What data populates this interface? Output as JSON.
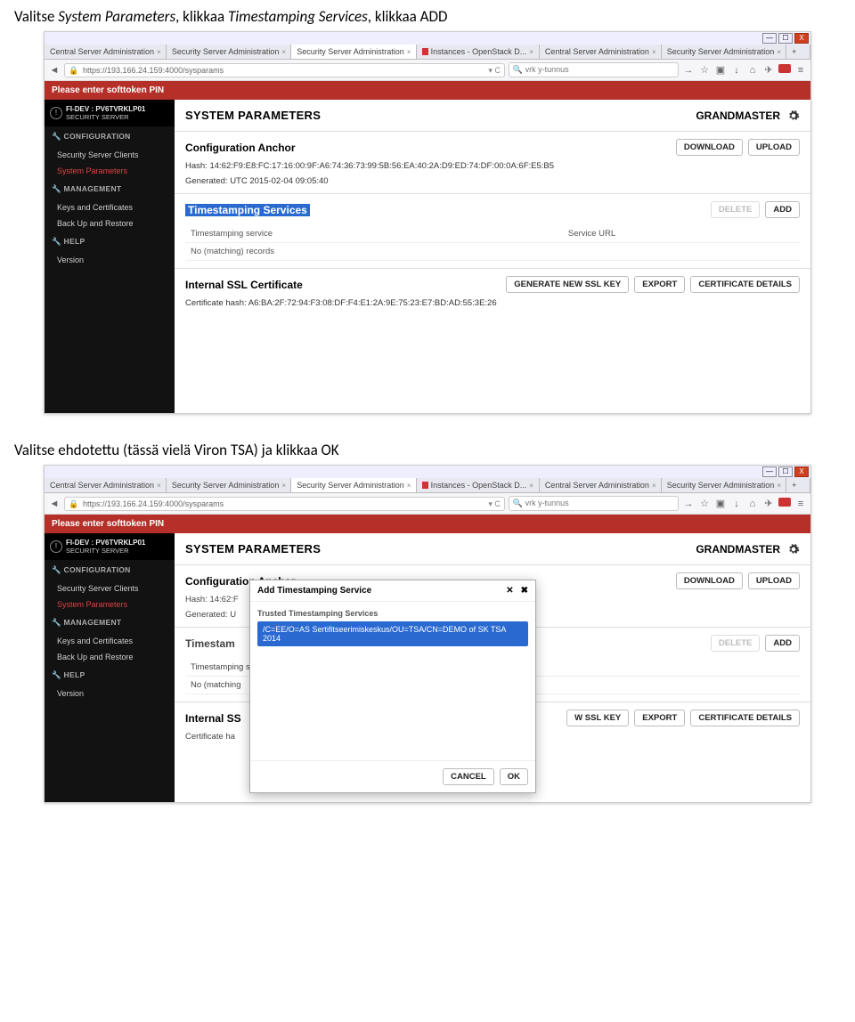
{
  "doc": {
    "line1_prefix": "Valitse ",
    "line1_em1": "System Parameters",
    "line1_mid": ", klikkaa ",
    "line1_em2": "Timestamping Services",
    "line1_suffix": ", klikkaa ADD",
    "line2": "Valitse ehdotettu (tässä vielä Viron TSA) ja klikkaa OK"
  },
  "browser": {
    "tabs": [
      "Central Server Administration",
      "Security Server Administration",
      "Security Server Administration",
      "Instances - OpenStack D...",
      "Central Server Administration",
      "Security Server Administration"
    ],
    "activeTabIndex": 2,
    "url": "https://193.166.24.159:4000/sysparams",
    "search": "vrk y-tunnus",
    "notice": "Please enter softtoken PIN"
  },
  "sidebar": {
    "id_line1": "FI-DEV : PV6TVRKLP01",
    "id_line2": "SECURITY SERVER",
    "sec_config": "CONFIGURATION",
    "items_config": [
      "Security Server Clients",
      "System Parameters"
    ],
    "config_selected": 1,
    "sec_mgmt": "MANAGEMENT",
    "items_mgmt": [
      "Keys and Certificates",
      "Back Up and Restore"
    ],
    "sec_help": "HELP",
    "items_help": [
      "Version"
    ]
  },
  "header": {
    "title": "SYSTEM PARAMETERS",
    "user": "GRANDMASTER"
  },
  "anchor": {
    "title": "Configuration Anchor",
    "btn_download": "DOWNLOAD",
    "btn_upload": "UPLOAD",
    "hash_label": "Hash:",
    "hash": "14:62:F9:E8:FC:17:16:00:9F:A6:74:36:73:99:5B:56:EA:40:2A:D9:ED:74:DF:00:0A:6F:E5:B5",
    "gen_label": "Generated:",
    "gen": "UTC 2015-02-04 09:05:40",
    "hash_short": "14:62:F",
    "gen_short": "U"
  },
  "ts": {
    "title": "Timestamping Services",
    "btn_delete": "DELETE",
    "btn_add": "ADD",
    "col1": "Timestamping service",
    "col2": "Service URL",
    "empty": "No (matching) records",
    "col1_short": "Timestamping s",
    "empty_short": "No (matching"
  },
  "ssl": {
    "title": "Internal SSL Certificate",
    "btn_gen": "GENERATE NEW SSL KEY",
    "btn_exp": "EXPORT",
    "btn_det": "CERTIFICATE DETAILS",
    "hash_label": "Certificate hash:",
    "hash": "A6:BA:2F:72:94:F3:08:DF:F4:E1:2A:9E:75:23:E7:BD:AD:55:3E:26",
    "title_short": "Internal SS",
    "btn_gen_short": "W SSL KEY",
    "hash_short": "Certificate ha"
  },
  "dialog": {
    "title": "Add Timestamping Service",
    "sub": "Trusted Timestamping Services",
    "item": "/C=EE/O=AS Sertifitseerimiskeskus/OU=TSA/CN=DEMO of SK TSA 2014",
    "btn_cancel": "CANCEL",
    "btn_ok": "OK"
  }
}
